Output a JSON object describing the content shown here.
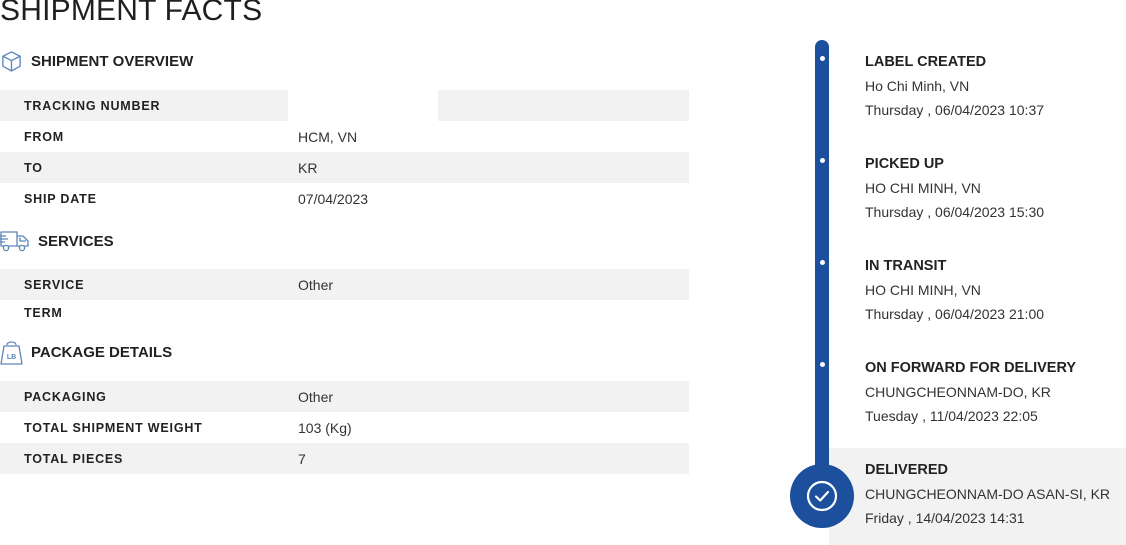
{
  "page_title": "SHIPMENT FACTS",
  "overview": {
    "heading": "SHIPMENT OVERVIEW",
    "rows": [
      {
        "label": "TRACKING NUMBER",
        "value": ""
      },
      {
        "label": "FROM",
        "value": "HCM, VN"
      },
      {
        "label": "TO",
        "value": "KR"
      },
      {
        "label": "SHIP DATE",
        "value": "07/04/2023"
      }
    ]
  },
  "services": {
    "heading": "SERVICES",
    "rows": [
      {
        "label": "SERVICE",
        "value": "Other"
      },
      {
        "label": "TERM",
        "value": ""
      }
    ]
  },
  "package": {
    "heading": "PACKAGE DETAILS",
    "icon_text": "LB",
    "rows": [
      {
        "label": "PACKAGING",
        "value": "Other"
      },
      {
        "label": "TOTAL SHIPMENT WEIGHT",
        "value": "103 (Kg)"
      },
      {
        "label": "TOTAL PIECES",
        "value": "7"
      }
    ]
  },
  "timeline": {
    "accent_color": "#1c4f9c",
    "events": [
      {
        "status": "LABEL CREATED",
        "location": "Ho Chi Minh, VN",
        "datetime": "Thursday , 06/04/2023 10:37"
      },
      {
        "status": "PICKED UP",
        "location": "HO CHI MINH, VN",
        "datetime": "Thursday , 06/04/2023 15:30"
      },
      {
        "status": "IN TRANSIT",
        "location": "HO CHI MINH, VN",
        "datetime": "Thursday , 06/04/2023 21:00"
      },
      {
        "status": "ON FORWARD FOR DELIVERY",
        "location": "CHUNGCHEONNAM-DO, KR",
        "datetime": "Tuesday , 11/04/2023 22:05"
      },
      {
        "status": "DELIVERED",
        "location": "CHUNGCHEONNAM-DO ASAN-SI, KR",
        "datetime": "Friday , 14/04/2023 14:31"
      }
    ]
  },
  "icons": {
    "overview": "box-icon",
    "services": "truck-icon",
    "package": "weight-bag-icon",
    "delivered": "checkmark-icon"
  }
}
